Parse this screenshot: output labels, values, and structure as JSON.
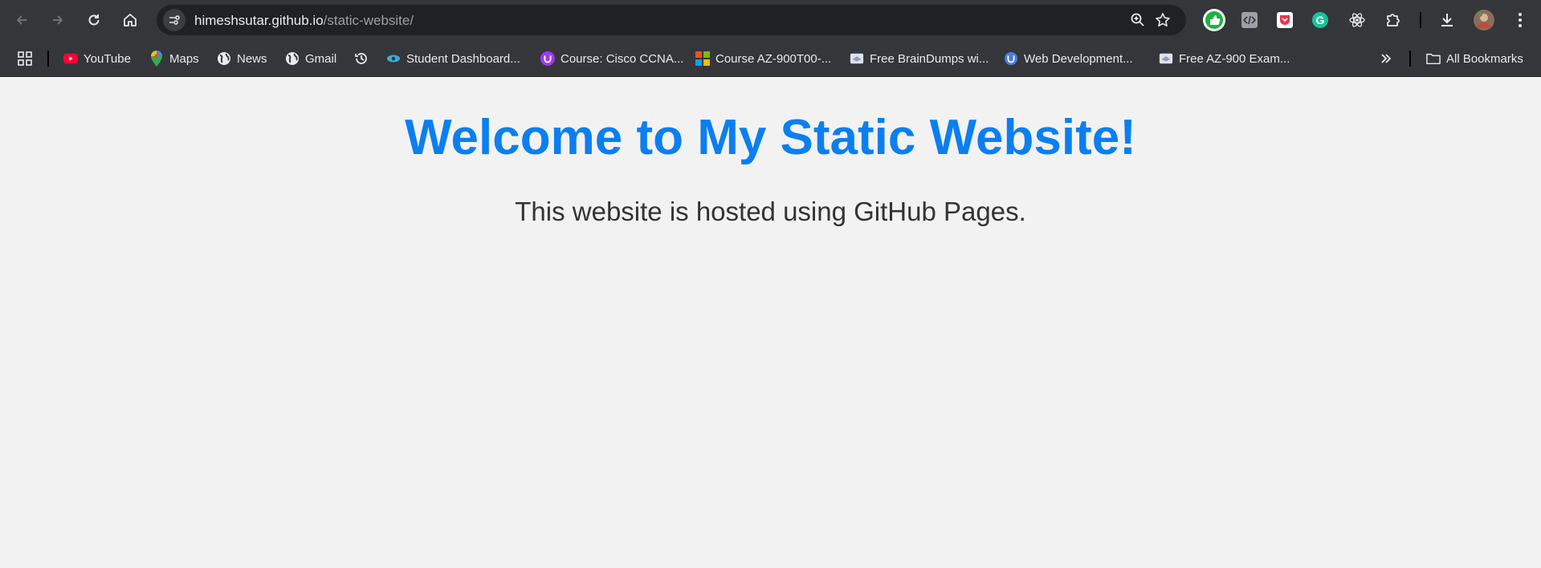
{
  "browser": {
    "url_host": "himeshsutar.github.io",
    "url_path": "/static-website/"
  },
  "nav_icons": [
    "back-arrow-icon",
    "forward-arrow-icon",
    "reload-icon",
    "home-icon"
  ],
  "bookmarks": [
    {
      "label": "YouTube",
      "icon": "youtube-icon"
    },
    {
      "label": "Maps",
      "icon": "maps-pin-icon"
    },
    {
      "label": "News",
      "icon": "globe-icon"
    },
    {
      "label": "Gmail",
      "icon": "globe-icon"
    },
    {
      "label": "Student Dashboard...",
      "icon": "cloud-eye-icon"
    },
    {
      "label": "Course: Cisco CCNA...",
      "icon": "udemy-icon"
    },
    {
      "label": "Course AZ-900T00-...",
      "icon": "microsoft-icon"
    },
    {
      "label": "Free BrainDumps wi...",
      "icon": "page-icon"
    },
    {
      "label": "Web Development...",
      "icon": "shield-icon"
    },
    {
      "label": "Free AZ-900 Exam...",
      "icon": "page-icon"
    }
  ],
  "all_bookmarks_label": "All Bookmarks",
  "page": {
    "heading": "Welcome to My Static Website!",
    "subtext": "This website is hosted using GitHub Pages."
  },
  "colors": {
    "heading": "#0b7ff0",
    "subtext": "#333333",
    "page_bg": "#f2f2f2",
    "chrome_bg": "#35363a"
  }
}
